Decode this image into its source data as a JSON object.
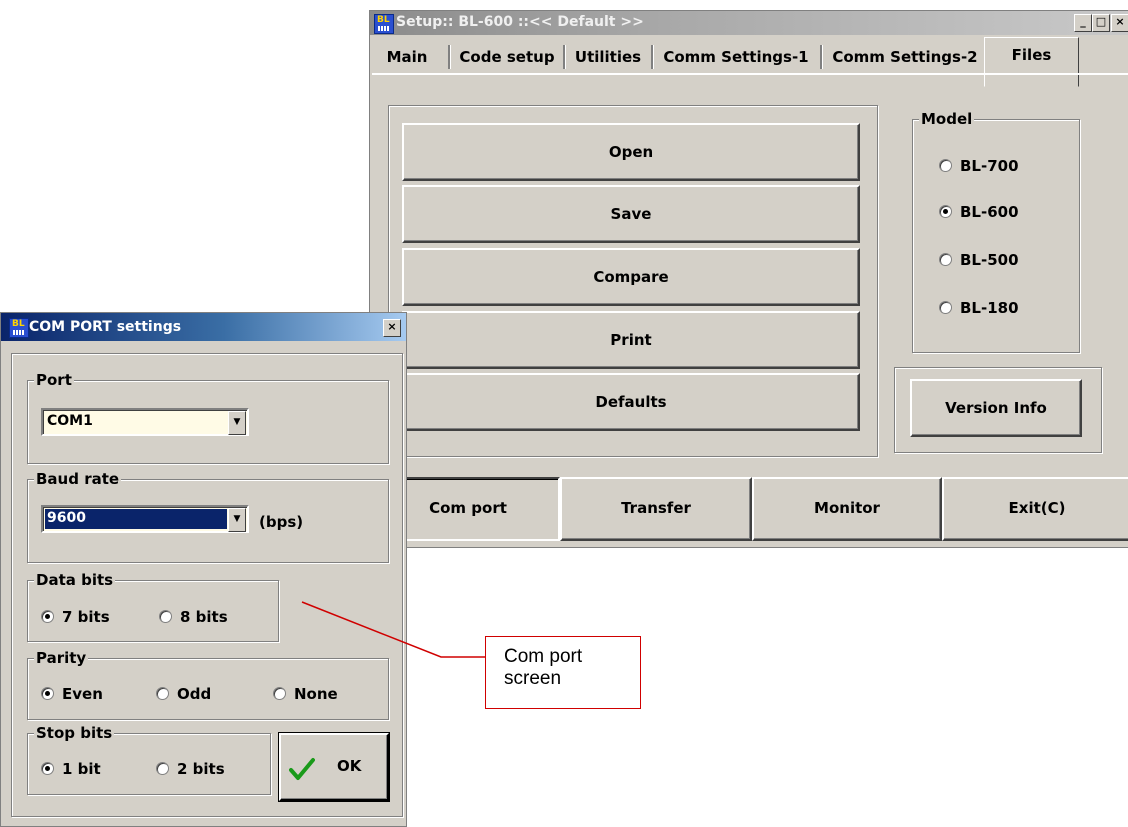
{
  "setup_window": {
    "title": "Setup:: BL-600 ::<< Default >>",
    "icon_text": "BL",
    "caption_buttons": [
      "_",
      "□",
      "×"
    ],
    "tabs": [
      "Main",
      "Code setup",
      "Utilities",
      "Comm Settings-1",
      "Comm Settings-2",
      "Files"
    ],
    "active_tab": "Files",
    "file_buttons": [
      "Open",
      "Save",
      "Compare",
      "Print",
      "Defaults"
    ],
    "model": {
      "legend": "Model",
      "options": [
        "BL-700",
        "BL-600",
        "BL-500",
        "BL-180"
      ],
      "selected": "BL-600"
    },
    "version_info_label": "Version Info",
    "bottom_buttons": [
      "Com port",
      "Transfer",
      "Monitor",
      "Exit(C)"
    ]
  },
  "com_dialog": {
    "title": "COM PORT settings",
    "icon_text": "BL",
    "close_label": "×",
    "port": {
      "legend": "Port",
      "value": "COM1"
    },
    "baud": {
      "legend": "Baud rate",
      "value": "9600",
      "unit": "(bps)"
    },
    "data_bits": {
      "legend": "Data bits",
      "options": [
        "7 bits",
        "8 bits"
      ],
      "selected": "7 bits"
    },
    "parity": {
      "legend": "Parity",
      "options": [
        "Even",
        "Odd",
        "None"
      ],
      "selected": "Even"
    },
    "stop_bits": {
      "legend": "Stop bits",
      "options": [
        "1 bit",
        "2 bits"
      ],
      "selected": "1 bit"
    },
    "ok_label": "OK",
    "ok_check_color": "#1a9a1a"
  },
  "callout": {
    "text_line1": "Com port",
    "text_line2": "screen",
    "color": "#d00000"
  }
}
